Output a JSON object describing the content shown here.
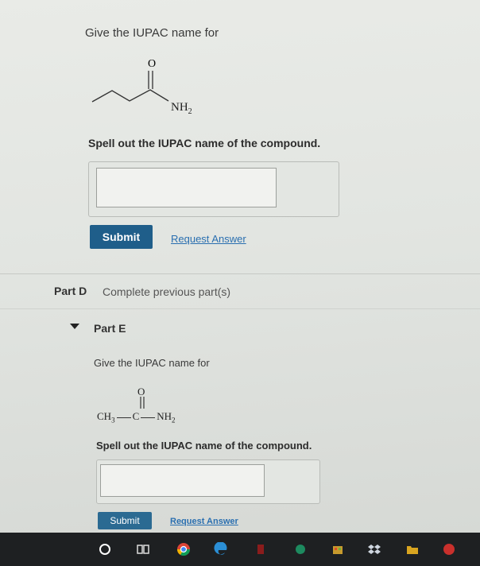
{
  "partC": {
    "prompt": "Give the IUPAC name for",
    "molecule": {
      "o_label": "O",
      "nh2_label": "NH",
      "nh2_sub": "2"
    },
    "instruction": "Spell out the IUPAC name of the compound.",
    "answer_value": "",
    "submit_label": "Submit",
    "request_label": "Request Answer"
  },
  "partD": {
    "label": "Part D",
    "status": "Complete previous part(s)"
  },
  "partE": {
    "label": "Part E",
    "prompt": "Give the IUPAC name for",
    "formula": {
      "o_label": "O",
      "ch3": "CH",
      "ch3_sub": "3",
      "c_label": "C",
      "nh2": "NH",
      "nh2_sub": "2"
    },
    "instruction": "Spell out the IUPAC name of the compound.",
    "answer_value": "",
    "submit_label": "Submit",
    "request_label": "Request Answer"
  },
  "taskbar": {
    "icons": [
      "cortana-circle-icon",
      "task-view-icon",
      "chrome-icon",
      "edge-icon",
      "app-icon",
      "app-icon",
      "store-icon",
      "dropbox-icon",
      "folder-icon",
      "app-icon"
    ]
  },
  "colors": {
    "accent": "#1f5e8a",
    "link": "#2a6fb0",
    "taskbar": "#1e2022"
  }
}
